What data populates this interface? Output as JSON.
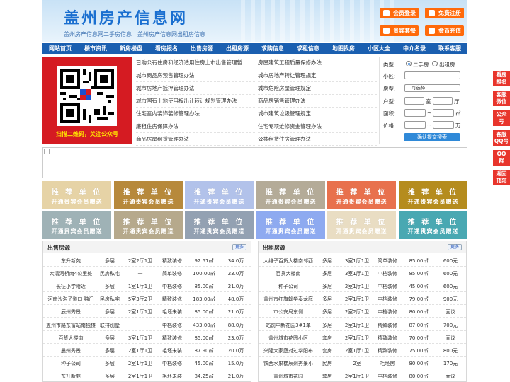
{
  "header": {
    "title": "盖州房产信息网",
    "subtitle": "盖州房产信息网二手房信息　盖州房产信息网出租房信息",
    "buttons": [
      {
        "label": "会员登录",
        "icon": "user-icon"
      },
      {
        "label": "免费注册",
        "icon": "register-icon"
      },
      {
        "label": "贵宾套餐",
        "icon": "vip-icon"
      },
      {
        "label": "金币充值",
        "icon": "coin-icon"
      }
    ]
  },
  "nav": [
    "网站首页",
    "楼市资讯",
    "新房楼盘",
    "看房报名",
    "出售房源",
    "出租房源",
    "求购信息",
    "求租信息",
    "地图找房",
    "小区大全",
    "中介名录",
    "联系客服"
  ],
  "qr": {
    "caption": "扫描二维码，关注公众号"
  },
  "news": {
    "left": [
      "已购公有住房和经济适用住房上市出售管理暂",
      "城市商品房预售管理办法",
      "城市房地产抵押管理办法",
      "城市国有土地使用权出让转让规划管理办法",
      "住宅室内装饰装修管理办法",
      "廉租住房保障办法",
      "商品房屋租赁管理办法"
    ],
    "right": [
      "房屋建筑工程质量保修办法",
      "城市房地产转让管理规定",
      "城市危险房屋管理规定",
      "商品房销售管理办法",
      "城市建筑垃圾管理规定",
      "住宅专项维修资金管理办法",
      "公共租赁住房管理办法"
    ]
  },
  "search": {
    "type_label": "类型:",
    "opt_sale": "二手房",
    "opt_rent": "出租房",
    "community_label": "小区:",
    "community_value": "",
    "house_type_label": "房型:",
    "house_type_value": "-- 可选择 --",
    "layout_label": "户型:",
    "room_unit": "室",
    "hall_unit": "厅",
    "area_label": "面积:",
    "area_unit": "㎡",
    "range_sep": "~",
    "price_label": "价格:",
    "price_unit": "万",
    "submit": "确认提交搜索"
  },
  "ads": {
    "title": "推 荐 单 位",
    "sub": "开通贵宾会员赠送",
    "colors": [
      "#e6d3a6",
      "#b7893b",
      "#b2c2ea",
      "#b4ab98",
      "#e8714d",
      "#b58c1e",
      "#9fb2b6",
      "#b6a98c",
      "#93a1b2",
      "#8eaaf0",
      "#e9ddc3",
      "#49a8b2"
    ]
  },
  "sale": {
    "title": "出售房源",
    "more": "更多",
    "rows": [
      [
        "东升新苑",
        "多层",
        "2室2厅1卫",
        "精致装修",
        "92.51㎡",
        "34.0万"
      ],
      [
        "大清河桥南4公里处",
        "民房私宅",
        "—",
        "简单装修",
        "100.00㎡",
        "23.0万"
      ],
      [
        "长征小学附近",
        "多层",
        "1室1厅1卫",
        "中档装修",
        "85.00㎡",
        "21.0万"
      ],
      [
        "河南沙沟子道口 独门",
        "民房私宅",
        "5室3厅2卫",
        "精致装修",
        "183.00㎡",
        "48.0万"
      ],
      [
        "辰州秀景",
        "多层",
        "2室1厅1卫",
        "毛坯未装",
        "85.00㎡",
        "21.0万"
      ],
      [
        "盖州市路东富站南独楼",
        "联排别墅",
        "—",
        "中档装修",
        "433.00㎡",
        "88.0万"
      ],
      [
        "百货大楼南",
        "多层",
        "3室1厅1卫",
        "精致装修",
        "85.00㎡",
        "23.0万"
      ],
      [
        "晨州秀景",
        "多层",
        "2室1厅1卫",
        "毛坯未装",
        "87.90㎡",
        "20.0万"
      ],
      [
        "种子公司",
        "多层",
        "2室1厅1卫",
        "中档装修",
        "45.00㎡",
        "15.0万"
      ],
      [
        "东升新苑",
        "多层",
        "2室1厅1卫",
        "毛坯未装",
        "84.25㎡",
        "21.0万"
      ]
    ]
  },
  "rent": {
    "title": "出租房源",
    "more": "更多",
    "rows": [
      [
        "大维子百货大楼南邻西",
        "多层",
        "3室1厅1卫",
        "简单装修",
        "85.00㎡",
        "600元"
      ],
      [
        "百货大楼南",
        "多层",
        "3室1厅1卫",
        "中档装修",
        "85.00㎡",
        "600元"
      ],
      [
        "种子公司",
        "多层",
        "2室1厅1卫",
        "中档装修",
        "45.00㎡",
        "600元"
      ],
      [
        "盖州市红旗翰华泰龙庭",
        "多层",
        "2室1厅1卫",
        "中档装修",
        "79.00㎡",
        "900元"
      ],
      [
        "市公安局东侧",
        "多层",
        "2室2厅1卫",
        "中档装修",
        "80.00㎡",
        "面议"
      ],
      [
        "站前中新花园3#1单",
        "多层",
        "2室1厅1卫",
        "精致装修",
        "87.00㎡",
        "700元"
      ],
      [
        "盖州城市花园小区",
        "套房",
        "2室1厅1卫",
        "精致装修",
        "70.00㎡",
        "面议"
      ],
      [
        "兴隆大家庭对过华阳布",
        "套房",
        "2室1厅1卫",
        "精致装修",
        "75.00㎡",
        "800元"
      ],
      [
        "铁西水果楼辰州秀景小",
        "民房",
        "2室",
        "毛坯房",
        "80.00㎡",
        "170元"
      ],
      [
        "盖州城市花园",
        "套房",
        "2室1厅1卫",
        "中档装修",
        "80.00㎡",
        "面议"
      ]
    ]
  },
  "sidebar": [
    "看房报名",
    "客服微信",
    "公众号",
    "客服QQ号",
    "QQ群",
    "返回顶部"
  ]
}
